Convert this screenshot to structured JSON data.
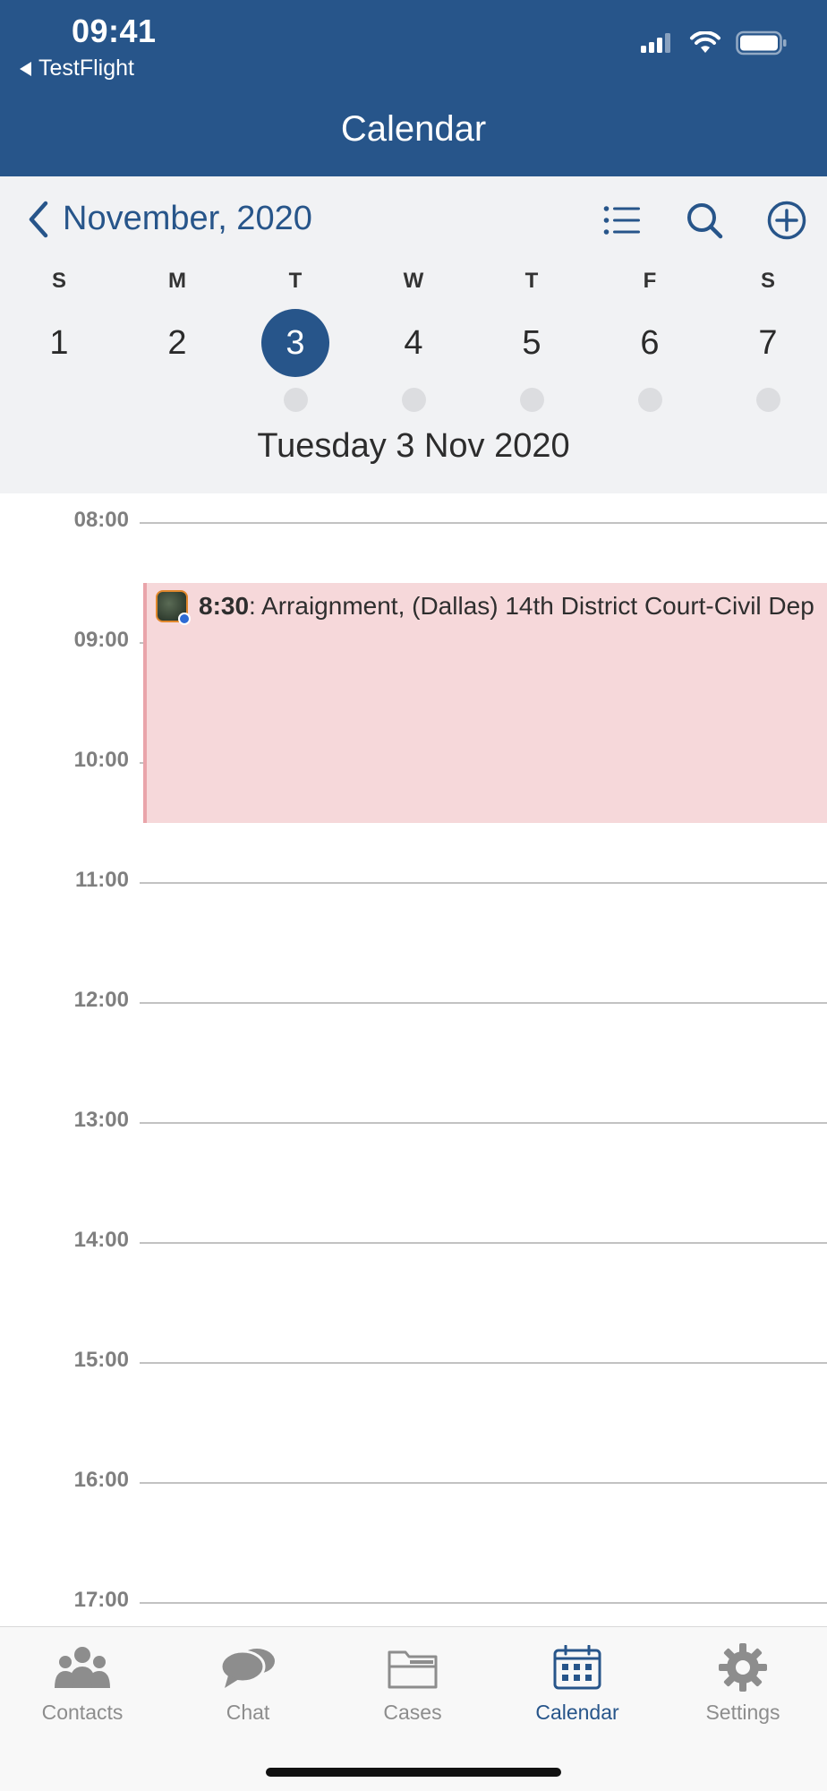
{
  "status_bar": {
    "time": "09:41",
    "back_app": "TestFlight"
  },
  "header": {
    "title": "Calendar"
  },
  "month_bar": {
    "month_label": "November, 2020"
  },
  "week": {
    "days": [
      {
        "dow": "S",
        "num": "1",
        "selected": false,
        "has_dot": false
      },
      {
        "dow": "M",
        "num": "2",
        "selected": false,
        "has_dot": false
      },
      {
        "dow": "T",
        "num": "3",
        "selected": true,
        "has_dot": true
      },
      {
        "dow": "W",
        "num": "4",
        "selected": false,
        "has_dot": true
      },
      {
        "dow": "T",
        "num": "5",
        "selected": false,
        "has_dot": true
      },
      {
        "dow": "F",
        "num": "6",
        "selected": false,
        "has_dot": true
      },
      {
        "dow": "S",
        "num": "7",
        "selected": false,
        "has_dot": true
      }
    ]
  },
  "selected_date_heading": "Tuesday 3 Nov 2020",
  "timeline": {
    "hours": [
      "08:00",
      "09:00",
      "10:00",
      "11:00",
      "12:00",
      "13:00",
      "14:00",
      "15:00",
      "16:00",
      "17:00"
    ]
  },
  "event": {
    "time": "8:30",
    "text": ": Arraignment, (Dallas) 14th District Court-Civil Dep"
  },
  "tabs": [
    {
      "label": "Contacts",
      "icon": "contacts-icon",
      "active": false
    },
    {
      "label": "Chat",
      "icon": "chat-icon",
      "active": false
    },
    {
      "label": "Cases",
      "icon": "cases-icon",
      "active": false
    },
    {
      "label": "Calendar",
      "icon": "calendar-icon",
      "active": true
    },
    {
      "label": "Settings",
      "icon": "settings-icon",
      "active": false
    }
  ],
  "colors": {
    "brand": "#27558a",
    "event_bg": "#f6d8da",
    "event_border": "#e9a4aa",
    "tab_inactive": "#8d8d8d"
  }
}
